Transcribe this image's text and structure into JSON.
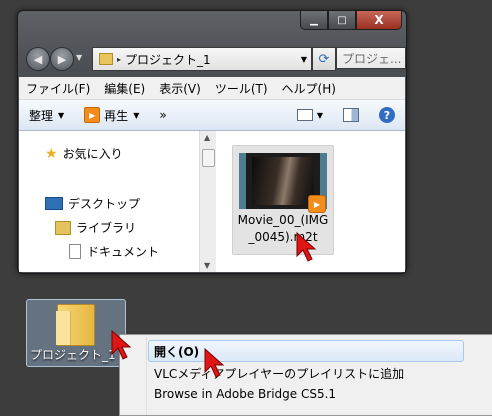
{
  "window": {
    "caption_buttons": {
      "minimize": "▁",
      "maximize": "□",
      "close": "X"
    },
    "nav": {
      "back": "◀",
      "forward": "▶",
      "dropdown": "▼"
    },
    "address": {
      "separator": "▸",
      "path": "プロジェクト_1",
      "dropdown": "▼"
    },
    "refresh_icon": "refresh-icon",
    "search_placeholder": "プロジェ..."
  },
  "menubar": [
    "ファイル(F)",
    "編集(E)",
    "表示(V)",
    "ツール(T)",
    "ヘルプ(H)"
  ],
  "toolbar": {
    "organize": "整理",
    "play": "再生",
    "more": "»",
    "arrow": "▼"
  },
  "navpane": {
    "favorites": "お気に入り",
    "desktop": "デスクトップ",
    "library": "ライブラリ",
    "documents": "ドキュメント"
  },
  "file": {
    "name": "Movie_00_(IMG_0045).m2t"
  },
  "desktop_icon": {
    "label": "プロジェクト_1"
  },
  "context_menu": {
    "items": [
      "開く(O)",
      "VLCメディアプレイヤーのプレイリストに追加",
      "Browse in Adobe Bridge CS5.1"
    ]
  },
  "colors": {
    "cursor": "#e01515",
    "desktop_bg": "#3d3d3d",
    "selection": "#a8c8ec"
  }
}
